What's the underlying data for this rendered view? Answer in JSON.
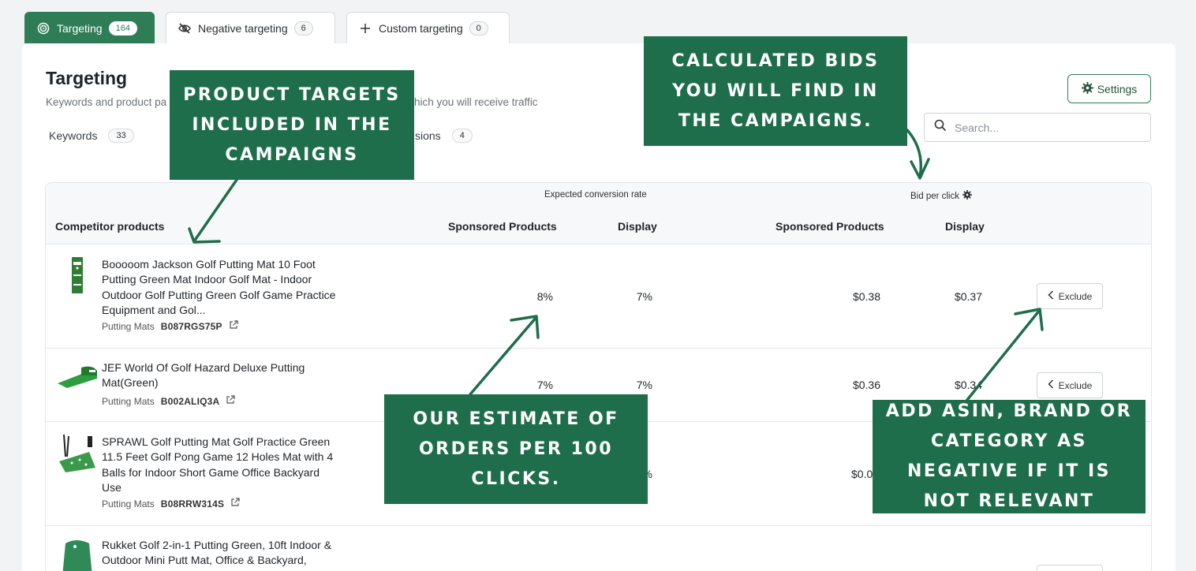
{
  "tabs": [
    {
      "label": "Targeting",
      "count": "164"
    },
    {
      "label": "Negative targeting",
      "count": "6"
    },
    {
      "label": "Custom targeting",
      "count": "0"
    }
  ],
  "page": {
    "title": "Targeting",
    "subtitle_left": "Keywords and product pa",
    "subtitle_right": "hich you will receive traffic"
  },
  "subtabs": [
    {
      "label": "Keywords",
      "count": "33"
    },
    {
      "label": "sions",
      "count": "4"
    }
  ],
  "settings_label": "Settings",
  "search": {
    "placeholder": "Search..."
  },
  "table": {
    "group_conversion": "Expected conversion rate",
    "group_bid": "Bid per click",
    "col_product": "Competitor products",
    "col_sp_conv": "Sponsored Products",
    "col_display_conv": "Display",
    "col_sp_bid": "Sponsored Products",
    "col_display_bid": "Display",
    "rows": [
      {
        "title": "Booooom Jackson Golf Putting Mat 10 Foot Putting Green Mat Indoor Golf Mat - Indoor Outdoor Golf Putting Green Golf Game Practice Equipment and Gol...",
        "category": "Putting Mats",
        "asin": "B087RGS75P",
        "sp_conv": "8%",
        "display_conv": "7%",
        "sp_bid": "$0.38",
        "display_bid": "$0.37",
        "action": "Exclude"
      },
      {
        "title": "JEF World Of Golf Hazard Deluxe Putting Mat(Green)",
        "category": "Putting Mats",
        "asin": "B002ALIQ3A",
        "sp_conv": "7%",
        "display_conv": "7%",
        "sp_bid": "$0.36",
        "display_bid": "$0.34",
        "action": "Exclude"
      },
      {
        "title": "SPRAWL Golf Putting Mat Golf Practice Green 11.5 Feet Golf Pong Game 12 Holes Mat with 4 Balls for Indoor Short Game Office Backyard Use",
        "category": "Putting Mats",
        "asin": "B08RRW314S",
        "display_conv": "%",
        "sp_bid": "$0.0"
      },
      {
        "title": "Rukket Golf 2-in-1 Putting Green, 10ft Indoor & Outdoor Mini Putt Mat, Office & Backyard,"
      }
    ]
  },
  "callouts": {
    "product_targets": "Product targets included in the campaigns",
    "calculated_bids": "Calculated bids you will find in the campaigns.",
    "estimate": "Our estimate of orders per 100 clicks.",
    "negative": "Add ASIN, brand or category as negative if it is not relevant"
  },
  "colors": {
    "brand_green": "#2f7d57",
    "callout_green": "#1e6e4b"
  }
}
